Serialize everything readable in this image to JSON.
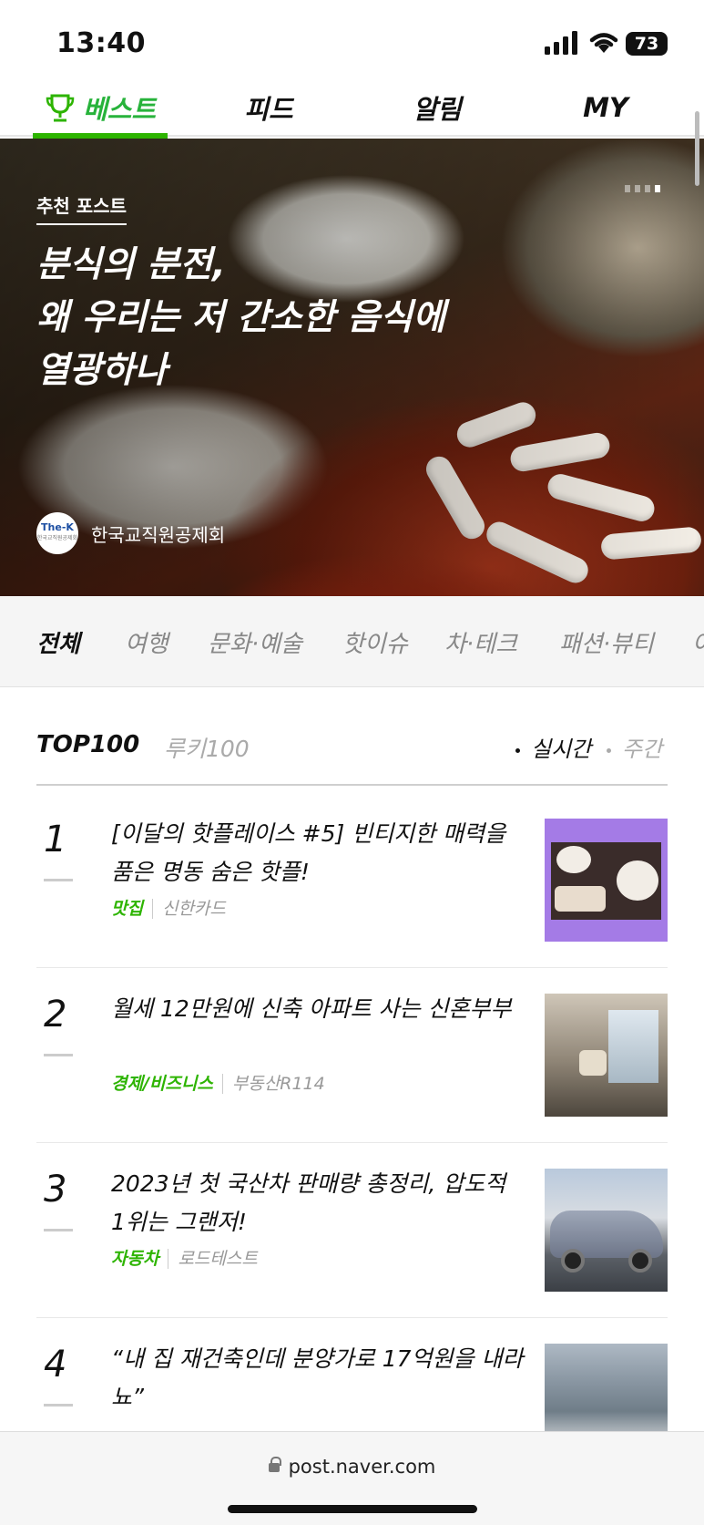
{
  "status_bar": {
    "time": "13:40",
    "battery": "73"
  },
  "tabs": [
    {
      "label": "베스트",
      "active": true
    },
    {
      "label": "피드"
    },
    {
      "label": "알림"
    },
    {
      "label": "MY"
    }
  ],
  "hero": {
    "label": "추천 포스트",
    "title_lines": [
      "분식의 분전,",
      "왜 우리는 저 간소한 음식에",
      "열광하나"
    ],
    "author": "한국교직원공제회",
    "avatar_text": "The-K",
    "avatar_sub": "한국교직원공제회",
    "page_indicator": {
      "count": 4,
      "active_index": 3
    }
  },
  "categories": [
    "전체",
    "여행",
    "문화·예술",
    "핫이슈",
    "차·테크",
    "패션·뷰티",
    "여"
  ],
  "top100": {
    "title": "TOP100",
    "rookie": "루키100",
    "realtime": "실시간",
    "weekly": "주간"
  },
  "items": [
    {
      "rank": "1",
      "title": "[이달의 핫플레이스 #5] 빈티지한 매력을 품은 명동 숨은 핫플!",
      "category": "맛집",
      "source": "신한카드"
    },
    {
      "rank": "2",
      "title": "월세 12만원에 신축 아파트 사는 신혼부부",
      "category": "경제/비즈니스",
      "source": "부동산R114"
    },
    {
      "rank": "3",
      "title": "2023년 첫 국산차 판매량 총정리, 압도적 1위는 그랜저!",
      "category": "자동차",
      "source": "로드테스트"
    },
    {
      "rank": "4",
      "title": "“내 집 재건축인데 분양가로 17억원을 내라뇨”",
      "category": "",
      "source": ""
    }
  ],
  "url": "post.naver.com",
  "colors": {
    "accent": "#2db400",
    "category_green": "#2db400"
  }
}
